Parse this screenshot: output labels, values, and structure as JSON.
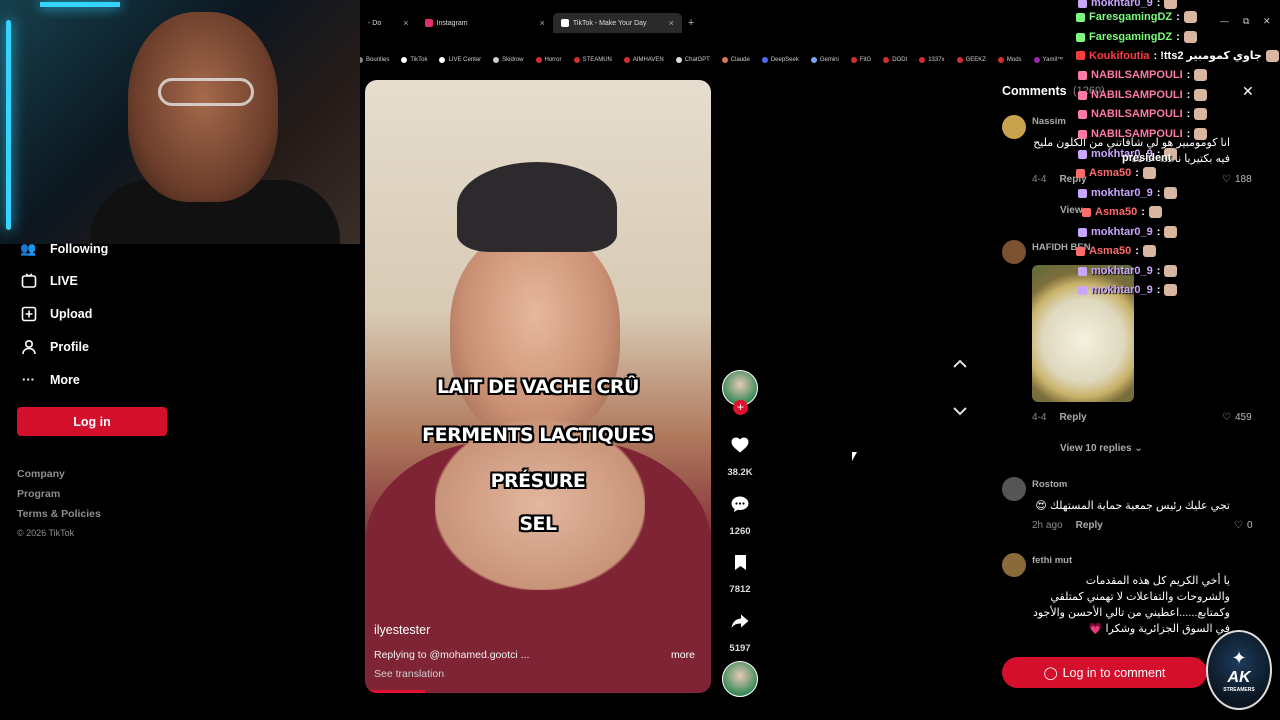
{
  "browser": {
    "tabs": [
      {
        "label": "- Do",
        "icon_color": "#555555"
      },
      {
        "label": "Instagram",
        "icon_color": "#e1306c"
      },
      {
        "label": "TikTok - Make Your Day",
        "icon_color": "#ffffff"
      }
    ],
    "new_tab": "+",
    "bookmarks": [
      {
        "label": "Bounties",
        "color": "#888888"
      },
      {
        "label": "TikTok",
        "color": "#ffffff"
      },
      {
        "label": "LIVE Center",
        "color": "#ffffff"
      },
      {
        "label": "Skidrow",
        "color": "#cccccc"
      },
      {
        "label": "Horror",
        "color": "#d32f2f"
      },
      {
        "label": "STEAMUN",
        "color": "#d32f2f"
      },
      {
        "label": "AIMHAVEN",
        "color": "#d32f2f"
      },
      {
        "label": "ChatGPT",
        "color": "#dddddd"
      },
      {
        "label": "Claude",
        "color": "#d97757"
      },
      {
        "label": "DeepSeek",
        "color": "#4d6bfe"
      },
      {
        "label": "Gemini",
        "color": "#7aa2f7"
      },
      {
        "label": "FitG",
        "color": "#d32f2f"
      },
      {
        "label": "DODI",
        "color": "#d32f2f"
      },
      {
        "label": "1337x",
        "color": "#d32f2f"
      },
      {
        "label": "GEEKZ",
        "color": "#d32f2f"
      },
      {
        "label": "Mods",
        "color": "#d32f2f"
      },
      {
        "label": "Yamil™",
        "color": "#9c27b0"
      }
    ]
  },
  "nav": {
    "items": [
      {
        "label": "Following",
        "icon": "following-icon"
      },
      {
        "label": "LIVE",
        "icon": "live-icon"
      },
      {
        "label": "Upload",
        "icon": "upload-icon"
      },
      {
        "label": "Profile",
        "icon": "profile-icon"
      },
      {
        "label": "More",
        "icon": "more-icon"
      }
    ],
    "login": "Log in",
    "footer": [
      "Company",
      "Program",
      "Terms & Policies"
    ],
    "copyright": "© 2026 TikTok"
  },
  "video": {
    "captions": [
      "LAIT DE VACHE CRÛ",
      "FERMENTS LACTIQUES",
      "PRÉSURE",
      "SEL"
    ],
    "username": "ilyestester",
    "description": "Replying to @mohamed.gootci ...",
    "more": "more",
    "see_translation": "See translation"
  },
  "actions": {
    "likes": "38.2K",
    "comments": "1260",
    "saves": "7812",
    "shares": "5197"
  },
  "comments": {
    "title": "Comments",
    "count": "(1260)",
    "login_button": "Log in to comment",
    "items": [
      {
        "name": "Nassim",
        "text": "انا كومومبير هو لي شافاتني من الكلون مليح فيه بكتيريا نافعة خاصة",
        "date": "4-4",
        "reply": "Reply",
        "likes": "188",
        "avatar_color": "#c9a24d",
        "view_replies": "View"
      },
      {
        "name": "HAFIDH BEN",
        "text": "",
        "date": "4-4",
        "reply": "Reply",
        "likes": "459",
        "avatar_color": "#7a5230",
        "view_replies": "View 10 replies"
      },
      {
        "name": "Rostom",
        "text": "تجي عليك رئيس جمعية حماية المستهلك 😍",
        "date": "2h ago",
        "reply": "Reply",
        "likes": "0",
        "avatar_color": "#555555"
      },
      {
        "name": "fethi mut",
        "text": "يا أخي الكريم كل هذه المقدمات والشروحات والتفاعلات لا تهمني كمتلقي وكمتابع......اعطيني من تالي الأحسن والأجود في السوق الجزائرية وشكرا 💗",
        "avatar_color": "#8a6a3a"
      }
    ]
  },
  "chat": [
    {
      "user": "mokhtar0_9",
      "msg": ":",
      "color": "#c9a7ff"
    },
    {
      "user": "FaresgamingDZ",
      "msg": ":",
      "color": "#7cfc7c"
    },
    {
      "user": "FaresgamingDZ",
      "msg": ":",
      "color": "#7cfc7c"
    },
    {
      "user": "Koukifoutia",
      "msg": ": !tts2 جاوي كمومبير",
      "color": "#ff3b3b"
    },
    {
      "user": "NABILSAMPOULI",
      "msg": ":",
      "color": "#ff7aa8"
    },
    {
      "user": "NABILSAMPOULI",
      "msg": ":",
      "color": "#ff7aa8"
    },
    {
      "user": "NABILSAMPOULI",
      "msg": ":",
      "color": "#ff7aa8"
    },
    {
      "user": "NABILSAMPOULI",
      "msg": ":",
      "color": "#ff7aa8"
    },
    {
      "user": "mokhtar0_9",
      "msg": ":",
      "color": "#c9a7ff"
    },
    {
      "user": "Asma50",
      "msg": ":",
      "color": "#ff6b6b"
    },
    {
      "user": "mokhtar0_9",
      "msg": ":",
      "color": "#c9a7ff"
    },
    {
      "user": "Asma50",
      "msg": ":",
      "color": "#ff6b6b"
    },
    {
      "user": "mokhtar0_9",
      "msg": ":",
      "color": "#c9a7ff"
    },
    {
      "user": "Asma50",
      "msg": ":",
      "color": "#ff6b6b"
    },
    {
      "user": "mokhtar0_9",
      "msg": ":",
      "color": "#c9a7ff"
    },
    {
      "user": "mokhtar0_9",
      "msg": ":",
      "color": "#c9a7ff"
    }
  ],
  "comment_word_overlay": "president",
  "logo": {
    "title": "AK",
    "subtitle": "STREAMERS"
  },
  "colors": {
    "accent": "#d30f2b",
    "bg": "#000000"
  }
}
